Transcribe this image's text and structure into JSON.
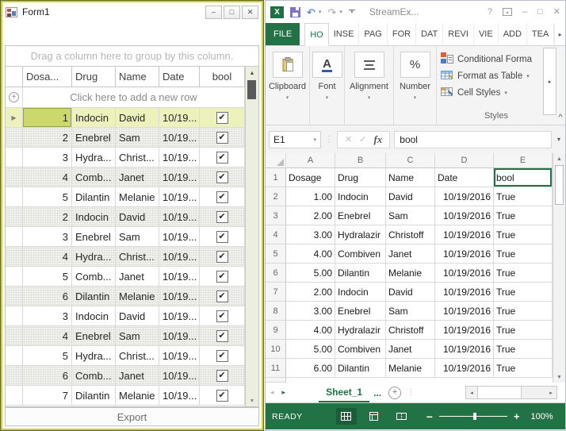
{
  "form_window": {
    "title": "Form1",
    "group_hint": "Drag a column here to group by this column.",
    "add_row_text": "Click here to add a new row",
    "export_label": "Export",
    "columns": [
      "Dosa...",
      "Drug",
      "Name",
      "Date",
      "bool"
    ],
    "rows": [
      {
        "dosage": "1",
        "drug": "Indocin",
        "name": "David",
        "date": "10/19...",
        "checked": true,
        "selected": true
      },
      {
        "dosage": "2",
        "drug": "Enebrel",
        "name": "Sam",
        "date": "10/19...",
        "checked": true,
        "selected": false
      },
      {
        "dosage": "3",
        "drug": "Hydra...",
        "name": "Christ...",
        "date": "10/19...",
        "checked": true,
        "selected": false
      },
      {
        "dosage": "4",
        "drug": "Comb...",
        "name": "Janet",
        "date": "10/19...",
        "checked": true,
        "selected": false
      },
      {
        "dosage": "5",
        "drug": "Dilantin",
        "name": "Melanie",
        "date": "10/19...",
        "checked": true,
        "selected": false
      },
      {
        "dosage": "2",
        "drug": "Indocin",
        "name": "David",
        "date": "10/19...",
        "checked": true,
        "selected": false
      },
      {
        "dosage": "3",
        "drug": "Enebrel",
        "name": "Sam",
        "date": "10/19...",
        "checked": true,
        "selected": false
      },
      {
        "dosage": "4",
        "drug": "Hydra...",
        "name": "Christ...",
        "date": "10/19...",
        "checked": true,
        "selected": false
      },
      {
        "dosage": "5",
        "drug": "Comb...",
        "name": "Janet",
        "date": "10/19...",
        "checked": true,
        "selected": false
      },
      {
        "dosage": "6",
        "drug": "Dilantin",
        "name": "Melanie",
        "date": "10/19...",
        "checked": true,
        "selected": false
      },
      {
        "dosage": "3",
        "drug": "Indocin",
        "name": "David",
        "date": "10/19...",
        "checked": true,
        "selected": false
      },
      {
        "dosage": "4",
        "drug": "Enebrel",
        "name": "Sam",
        "date": "10/19...",
        "checked": true,
        "selected": false
      },
      {
        "dosage": "5",
        "drug": "Hydra...",
        "name": "Christ...",
        "date": "10/19...",
        "checked": true,
        "selected": false
      },
      {
        "dosage": "6",
        "drug": "Comb...",
        "name": "Janet",
        "date": "10/19...",
        "checked": true,
        "selected": false
      },
      {
        "dosage": "7",
        "drug": "Dilantin",
        "name": "Melanie",
        "date": "10/19...",
        "checked": true,
        "selected": false
      }
    ]
  },
  "excel_window": {
    "title": "StreamEx...",
    "file_tab": "FILE",
    "ribbon_tabs": [
      "HO",
      "INSE",
      "PAG",
      "FOR",
      "DAT",
      "REVI",
      "VIE",
      "ADD",
      "TEA"
    ],
    "active_tab": "HO",
    "ribbon_groups": [
      "Clipboard",
      "Font",
      "Alignment",
      "Number"
    ],
    "styles_group": {
      "label": "Styles",
      "buttons": [
        "Conditional Forma",
        "Format as Table",
        "Cell Styles"
      ]
    },
    "formula_bar": {
      "name_box": "E1",
      "fx_label": "fx",
      "value": "bool"
    },
    "grid": {
      "columns": [
        "A",
        "B",
        "C",
        "D",
        "E"
      ],
      "selected_cell": "E1",
      "rows": [
        [
          "Dosage",
          "Drug",
          "Name",
          "Date",
          "bool"
        ],
        [
          "1.00",
          "Indocin",
          "David",
          "10/19/2016",
          "True"
        ],
        [
          "2.00",
          "Enebrel",
          "Sam",
          "10/19/2016",
          "True"
        ],
        [
          "3.00",
          "Hydralazir",
          "Christoff",
          "10/19/2016",
          "True"
        ],
        [
          "4.00",
          "Combiven",
          "Janet",
          "10/19/2016",
          "True"
        ],
        [
          "5.00",
          "Dilantin",
          "Melanie",
          "10/19/2016",
          "True"
        ],
        [
          "2.00",
          "Indocin",
          "David",
          "10/19/2016",
          "True"
        ],
        [
          "3.00",
          "Enebrel",
          "Sam",
          "10/19/2016",
          "True"
        ],
        [
          "4.00",
          "Hydralazir",
          "Christoff",
          "10/19/2016",
          "True"
        ],
        [
          "5.00",
          "Combiven",
          "Janet",
          "10/19/2016",
          "True"
        ],
        [
          "6.00",
          "Dilantin",
          "Melanie",
          "10/19/2016",
          "True"
        ]
      ]
    },
    "sheet_tabs": {
      "active": "Sheet_1",
      "overflow": "..."
    },
    "status_bar": {
      "mode": "READY",
      "zoom": "100%"
    }
  },
  "icons": {
    "checkbox_check": "✔",
    "selected_row_arrow": "▶",
    "add_row_plus": "+",
    "scroll_up": "▲",
    "scroll_down": "▼",
    "undo": "↶",
    "redo": "↷",
    "dropdown": "▾",
    "help": "?",
    "minimize": "–",
    "maximize": "□",
    "close": "✕",
    "cancel": "✕",
    "enter": "✓",
    "tabs_more": "▸",
    "ribbon_collapse": "^",
    "ribbon_display_arrow": "▴",
    "nav_left": "◂",
    "nav_right": "▸",
    "dots_separator": "⋮",
    "zoom_out": "−",
    "zoom_in": "+"
  },
  "colors": {
    "excel_green": "#217346",
    "form_border": "#c6d13b",
    "selected_cell_fill": "#cbd96c",
    "selected_row_fill": "#edf2bd",
    "font_underline_blue": "#2d5fa8"
  }
}
